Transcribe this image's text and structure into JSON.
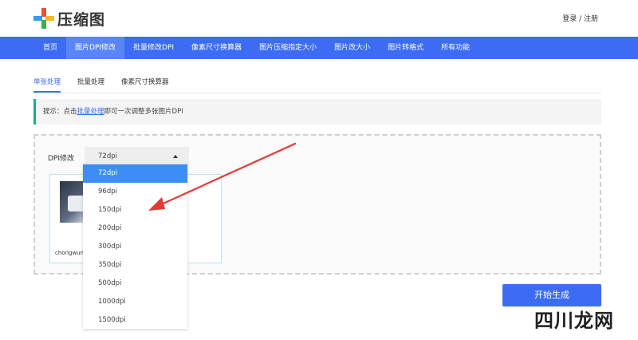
{
  "header": {
    "logo_text": "压缩图",
    "login": "登录",
    "sep": " / ",
    "register": "注册"
  },
  "nav": {
    "items": [
      "首页",
      "图片DPI修改",
      "批量修改DPI",
      "像素尺寸换算器",
      "图片压缩指定大小",
      "图片改大小",
      "图片转格式",
      "所有功能"
    ]
  },
  "tabs": {
    "items": [
      "单张处理",
      "批量处理",
      "像素尺寸换算器"
    ]
  },
  "tip": {
    "prefix": "提示：点击",
    "link": "批量处理",
    "suffix": "即可一次调整多张图片DPI"
  },
  "form": {
    "dpi_label": "DPI修改",
    "selected": "72dpi",
    "options": [
      "72dpi",
      "96dpi",
      "150dpi",
      "200dpi",
      "300dpi",
      "350dpi",
      "500dpi",
      "1000dpi",
      "1500dpi"
    ]
  },
  "file": {
    "name": "chongwuma"
  },
  "actions": {
    "generate": "开始生成"
  },
  "watermark": "四川龙网",
  "colors": {
    "primary": "#3c6cf3",
    "option_selected": "#3c8df5",
    "tip_border": "#1bae81",
    "arrow": "#e53935"
  }
}
